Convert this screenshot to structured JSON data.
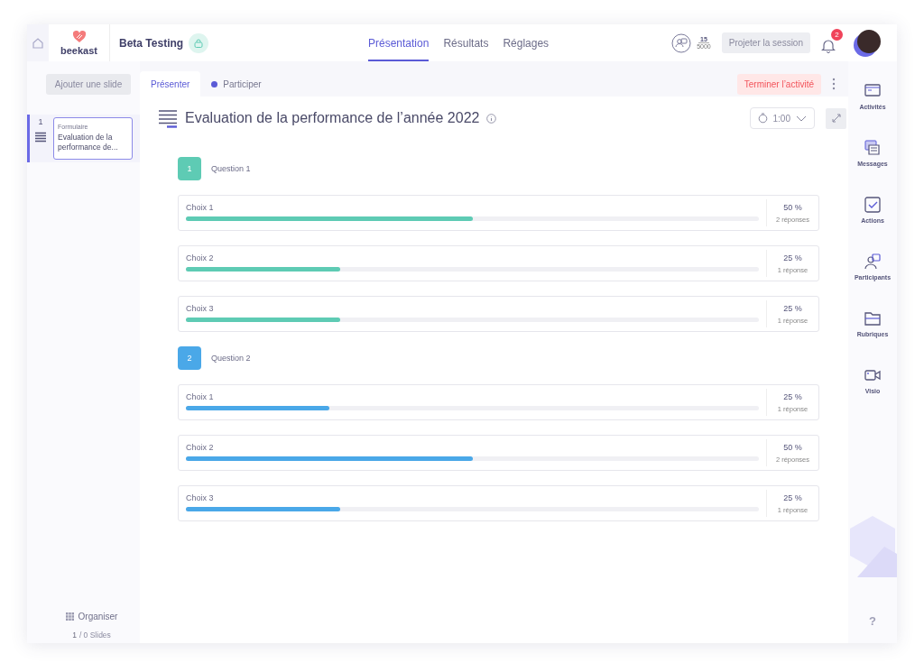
{
  "header": {
    "logo_text": "beekast",
    "session_title": "Beta Testing",
    "nav": [
      {
        "label": "Présentation",
        "selected": true
      },
      {
        "label": "Résultats",
        "selected": false
      },
      {
        "label": "Réglages",
        "selected": false
      }
    ],
    "participants_count": "15",
    "participants_max": "5000",
    "project_button": "Projeter la session",
    "notifications": "2"
  },
  "sidebar": {
    "add_button": "Ajouter une slide",
    "slides": [
      {
        "number": "1",
        "type": "Formulaire",
        "title": "Evaluation de la performance de...",
        "selected": true
      }
    ],
    "organise": "Organiser",
    "slide_index": "1",
    "slide_total": "/ 0 Slides"
  },
  "main": {
    "tabs": [
      {
        "label": "Présenter",
        "selected": true
      },
      {
        "label": "Participer",
        "selected": false
      }
    ],
    "end_button": "Terminer l’activité",
    "title": "Evaluation de la performance de l’année 2022",
    "timer": "1:00",
    "questions": [
      {
        "number": "1",
        "label": "Question 1",
        "color": "#5ecbb4",
        "choices": [
          {
            "label": "Choix 1",
            "level": 0.5,
            "percent": "50 %",
            "answers": "2 réponses"
          },
          {
            "label": "Choix 2",
            "level": 0.27,
            "percent": "25 %",
            "answers": "1 réponse"
          },
          {
            "label": "Choix 3",
            "level": 0.27,
            "percent": "25 %",
            "answers": "1 réponse"
          }
        ]
      },
      {
        "number": "2",
        "label": "Question 2",
        "color": "#4aa8e8",
        "choices": [
          {
            "label": "Choix 1",
            "level": 0.25,
            "percent": "25 %",
            "answers": "1 réponse"
          },
          {
            "label": "Choix 2",
            "level": 0.5,
            "percent": "50 %",
            "answers": "2 réponses"
          },
          {
            "label": "Choix 3",
            "level": 0.27,
            "percent": "25 %",
            "answers": "1 réponse"
          }
        ]
      }
    ]
  },
  "rail": [
    {
      "label": "Activités",
      "kind": "activities"
    },
    {
      "label": "Messages",
      "kind": "messages"
    },
    {
      "label": "Actions",
      "kind": "actions"
    },
    {
      "label": "Participants",
      "kind": "participants"
    },
    {
      "label": "Rubriques",
      "kind": "folder"
    },
    {
      "label": "Visio",
      "kind": "video"
    }
  ],
  "help": "?"
}
